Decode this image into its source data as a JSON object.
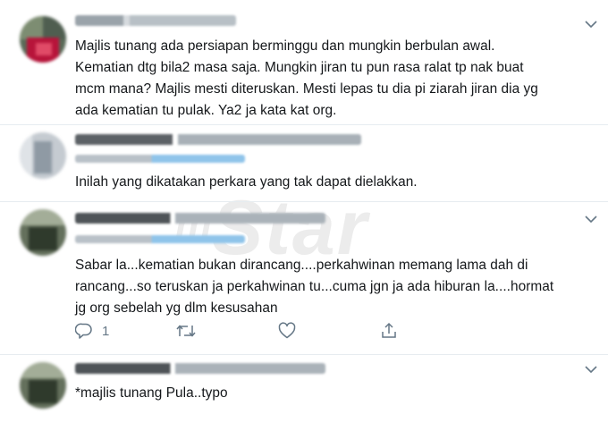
{
  "tweets": [
    {
      "text": "Majlis tunang ada persiapan berminggu dan mungkin berbulan awal.\nKematian dtg bila2 masa saja. Mungkin jiran tu pun rasa ralat tp nak buat\nmcm mana? Majlis mesti diteruskan. Mesti lepas tu dia pi ziarah jiran dia yg\nada kematian tu pulak. Ya2 ja kata kat org."
    },
    {
      "text": "Inilah yang dikatakan perkara yang tak dapat dielakkan."
    },
    {
      "text": "Sabar la...kematian bukan dirancang....perkahwinan memang lama dah di\nrancang...so teruskan ja perkahwinan tu...cuma jgn ja ada hiburan la....hormat\njg org sebelah yg dlm kesusahan",
      "reply_count": "1"
    },
    {
      "text": "*majlis tunang Pula..typo"
    }
  ],
  "watermark": {
    "prefix": "m",
    "word": "Star"
  },
  "colors": {
    "muted": "#657786",
    "divider": "#e6ecf0",
    "link": "#1da1f2"
  },
  "icons": [
    "chevron-down-icon",
    "reply-icon",
    "retweet-icon",
    "like-icon",
    "share-icon"
  ]
}
